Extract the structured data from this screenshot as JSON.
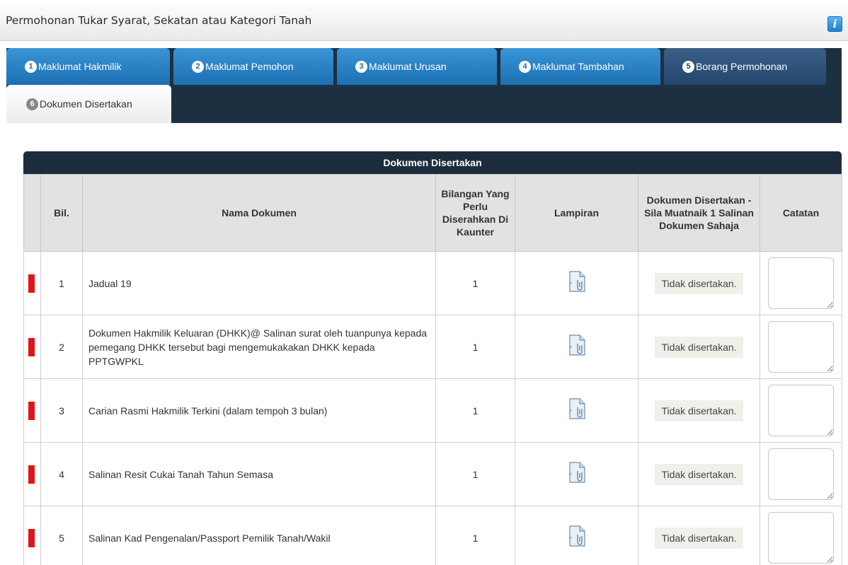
{
  "header": {
    "title": "Permohonan Tukar Syarat, Sekatan atau Kategori Tanah",
    "info_icon": "i"
  },
  "tabs": [
    {
      "number": "1",
      "label": "Maklumat Hakmilik"
    },
    {
      "number": "2",
      "label": "Maklumat Pemohon"
    },
    {
      "number": "3",
      "label": "Maklumat Urusan"
    },
    {
      "number": "4",
      "label": "Maklumat Tambahan"
    },
    {
      "number": "5",
      "label": "Borang Permohonan"
    },
    {
      "number": "6",
      "label": "Dokumen Disertakan"
    }
  ],
  "table": {
    "caption": "Dokumen Disertakan",
    "headers": {
      "bil": "Bil.",
      "nama": "Nama Dokumen",
      "bilangan": "Bilangan Yang Perlu Diserahkan Di Kaunter",
      "lampiran": "Lampiran",
      "dokumen": "Dokumen Disertakan - Sila Muatnaik 1 Salinan Dokumen Sahaja",
      "catatan": "Catatan"
    },
    "rows": [
      {
        "bil": "1",
        "nama": "Jadual 19",
        "bilangan": "1",
        "status": "Tidak disertakan."
      },
      {
        "bil": "2",
        "nama": "Dokumen Hakmilik Keluaran (DHKK)@ Salinan surat oleh tuanpunya kepada pemegang DHKK tersebut bagi mengemukakakan DHKK kepada PPTGWPKL",
        "bilangan": "1",
        "status": "Tidak disertakan."
      },
      {
        "bil": "3",
        "nama": "Carian Rasmi Hakmilik Terkini (dalam tempoh 3 bulan)",
        "bilangan": "1",
        "status": "Tidak disertakan."
      },
      {
        "bil": "4",
        "nama": "Salinan Resit Cukai Tanah Tahun Semasa",
        "bilangan": "1",
        "status": "Tidak disertakan."
      },
      {
        "bil": "5",
        "nama": "Salinan Kad Pengenalan/Passport Pemilik Tanah/Wakil",
        "bilangan": "1",
        "status": "Tidak disertakan."
      }
    ]
  },
  "colors": {
    "tab_blue": "#2b85c7",
    "tab_selected_dark": "#2f5379",
    "panel_dark": "#1d3041",
    "required_flag": "#e0141a"
  },
  "icons": {
    "row_flag": "required-flag-icon",
    "attachment": "attachment-file-icon"
  }
}
